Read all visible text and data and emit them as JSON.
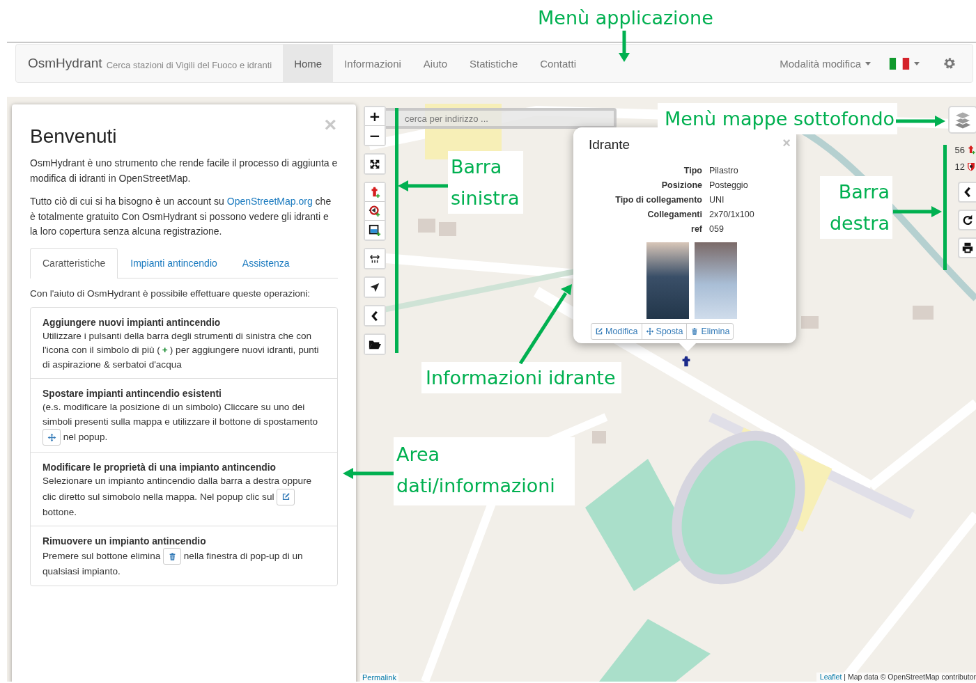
{
  "annotations": [
    {
      "text": "Menù applicazione"
    },
    {
      "text": "Menù mappe sottofondo"
    },
    {
      "text": "Barra sinistra"
    },
    {
      "text": "Barra destra"
    },
    {
      "text": "Informazioni idrante"
    },
    {
      "text": "Area dati/informazioni"
    }
  ],
  "navbar": {
    "brand": "OsmHydrant",
    "tagline": "Cerca stazioni di Vigili del Fuoco e idranti",
    "items": [
      {
        "label": "Home",
        "selected": true
      },
      {
        "label": "Informazioni",
        "selected": false
      },
      {
        "label": "Aiuto",
        "selected": false
      },
      {
        "label": "Statistiche",
        "selected": false
      },
      {
        "label": "Contatti",
        "selected": false
      }
    ],
    "mode_menu": "Modalità modifica"
  },
  "welcome": {
    "title": "Benvenuti",
    "close": "×",
    "paragraphs": [
      [
        {
          "kind": "text",
          "text": "OsmHydrant è uno strumento che rende facile il processo di aggiunta e modifica di idranti in OpenStreetMap."
        }
      ],
      [
        {
          "kind": "text",
          "text": "Tutto ciò di cui si ha bisogno è un account su "
        },
        {
          "kind": "link",
          "text": "OpenStreetMap.org"
        },
        {
          "kind": "text",
          "text": " che è totalmente gratuito Con OsmHydrant si possono vedere gli idranti e la loro copertura senza alcuna registrazione."
        }
      ]
    ],
    "tabs": [
      {
        "label": "Caratteristiche",
        "selected": true
      },
      {
        "label": "Impianti antincendio",
        "selected": false
      },
      {
        "label": "Assistenza",
        "selected": false
      }
    ],
    "intro": "Con l'aiuto di OsmHydrant è possibile effettuare queste operazioni:",
    "operations": [
      {
        "title": "Aggiungere nuovi impianti antincendio",
        "body": [
          {
            "kind": "text",
            "text": "Utilizzare i pulsanti della barra degli strumenti di sinistra che con l'icona con il simbolo di più ("
          },
          {
            "kind": "plus",
            "text": "+"
          },
          {
            "kind": "text",
            "text": ") per aggiungere nuovi idranti, punti di aspirazione & serbatoi d'acqua"
          }
        ]
      },
      {
        "title": "Spostare impianti antincendio esistenti",
        "body": [
          {
            "kind": "text",
            "text": "(e.s. modificare la posizione di un simbolo) Cliccare su uno dei simboli presenti sulla mappa e utilizzare il bottone di spostamento "
          },
          {
            "kind": "icon"
          },
          {
            "kind": "text",
            "text": " nel popup."
          }
        ]
      },
      {
        "title": "Modificare le proprietà di una impianto antincendio",
        "body": [
          {
            "kind": "text",
            "text": "Selezionare un impianto antincendio dalla barra a destra oppure clic diretto sul simobolo nella mappa. Nel popup clic sul "
          },
          {
            "kind": "icon"
          },
          {
            "kind": "text",
            "text": " bottone."
          }
        ]
      },
      {
        "title": "Rimuovere un impianto antincendio",
        "body": [
          {
            "kind": "text",
            "text": "Premere sul bottone elimina "
          },
          {
            "kind": "icon"
          },
          {
            "kind": "text",
            "text": " nella finestra di pop-up di un qualsiasi impianto."
          }
        ]
      }
    ]
  },
  "map": {
    "search": {
      "placeholder": "cerca per indirizzo ..."
    },
    "zoom": [
      "+",
      "−"
    ],
    "counters": [
      {
        "count": "56",
        "kind": "hydrant"
      },
      {
        "count": "12",
        "kind": "station"
      }
    ],
    "permalink": "Permalink",
    "attribution_link": "Leaflet",
    "attribution": "| Map data © OpenStreetMap contributor"
  },
  "popup": {
    "title": "Idrante",
    "close": "×",
    "rows": [
      {
        "label": "Tipo",
        "value": "Pilastro"
      },
      {
        "label": "Posizione",
        "value": "Posteggio"
      },
      {
        "label": "Tipo di collegamento",
        "value": "UNI"
      },
      {
        "label": "Collegamenti",
        "value": "2x70/1x100"
      },
      {
        "label": "ref",
        "value": "059"
      }
    ],
    "buttons": [
      {
        "label": "Modifica"
      },
      {
        "label": "Sposta"
      },
      {
        "label": "Elimina"
      }
    ]
  }
}
